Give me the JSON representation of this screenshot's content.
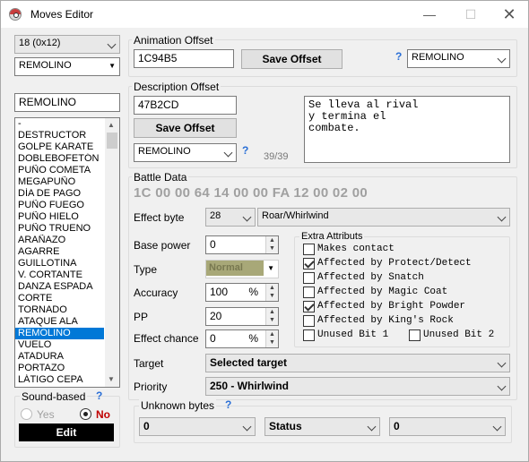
{
  "window": {
    "title": "Moves Editor",
    "minimize_glyph": "—",
    "maximize_glyph": "☐",
    "close_glyph": "✕"
  },
  "left": {
    "move_index_select": "18 (0x12)",
    "move_name_select": "REMOLINO",
    "search_value": "REMOLINO",
    "moves_list": [
      "-",
      "DESTRUCTOR",
      "GOLPE KARATE",
      "DOBLEBOFETÓN",
      "PUÑO COMETA",
      "MEGAPUÑO",
      "DÍA DE PAGO",
      "PUÑO FUEGO",
      "PUÑO HIELO",
      "PUÑO TRUENO",
      "ARAÑAZO",
      "AGARRE",
      "GUILLOTINA",
      "V. CORTANTE",
      "DANZA ESPADA",
      "CORTE",
      "TORNADO",
      "ATAQUE ALA",
      "REMOLINO",
      "VUELO",
      "ATADURA",
      "PORTAZO",
      "LÁTIGO CEPA"
    ],
    "selected_index": 18,
    "sound_based": {
      "label": "Sound-based",
      "help": "?",
      "yes": "Yes",
      "no": "No"
    },
    "edit_label": "Edit"
  },
  "animation": {
    "label": "Animation Offset",
    "offset_value": "1C94B5",
    "save_label": "Save Offset",
    "help": "?",
    "move_select": "REMOLINO"
  },
  "description": {
    "label": "Description Offset",
    "offset_value": "47B2CD",
    "save_label": "Save Offset",
    "move_select": "REMOLINO",
    "help": "?",
    "counter": "39/39",
    "text": "Se lleva al rival\ny termina el\ncombate."
  },
  "battle": {
    "label": "Battle Data",
    "hex": "1C 00 00 64 14 00 00 FA 12 00 02 00",
    "effect_byte_label": "Effect byte",
    "effect_byte_value": "28",
    "effect_name": "Roar/Whirlwind",
    "base_power_label": "Base power",
    "base_power_value": "0",
    "type_label": "Type",
    "type_value": "Normal",
    "type_color": "#a8a878",
    "accuracy_label": "Accuracy",
    "accuracy_value": "100",
    "pp_label": "PP",
    "pp_value": "20",
    "effect_chance_label": "Effect chance",
    "effect_chance_value": "0",
    "percent": "%",
    "extra": {
      "label": "Extra Attributs",
      "makes_contact": "Makes contact",
      "protect_detect": "Affected by Protect/Detect",
      "snatch": "Affected by Snatch",
      "magic_coat": "Affected by Magic Coat",
      "bright_powder": "Affected by Bright Powder",
      "kings_rock": "Affected by King's Rock",
      "unused1": "Unused Bit 1",
      "unused2": "Unused Bit 2"
    },
    "target_label": "Target",
    "target_value": "Selected target",
    "priority_label": "Priority",
    "priority_value": "250 - Whirlwind",
    "unknown_label": "Unknown bytes",
    "unknown_help": "?",
    "unknown1": "0",
    "unknown2": "Status",
    "unknown3": "0"
  }
}
